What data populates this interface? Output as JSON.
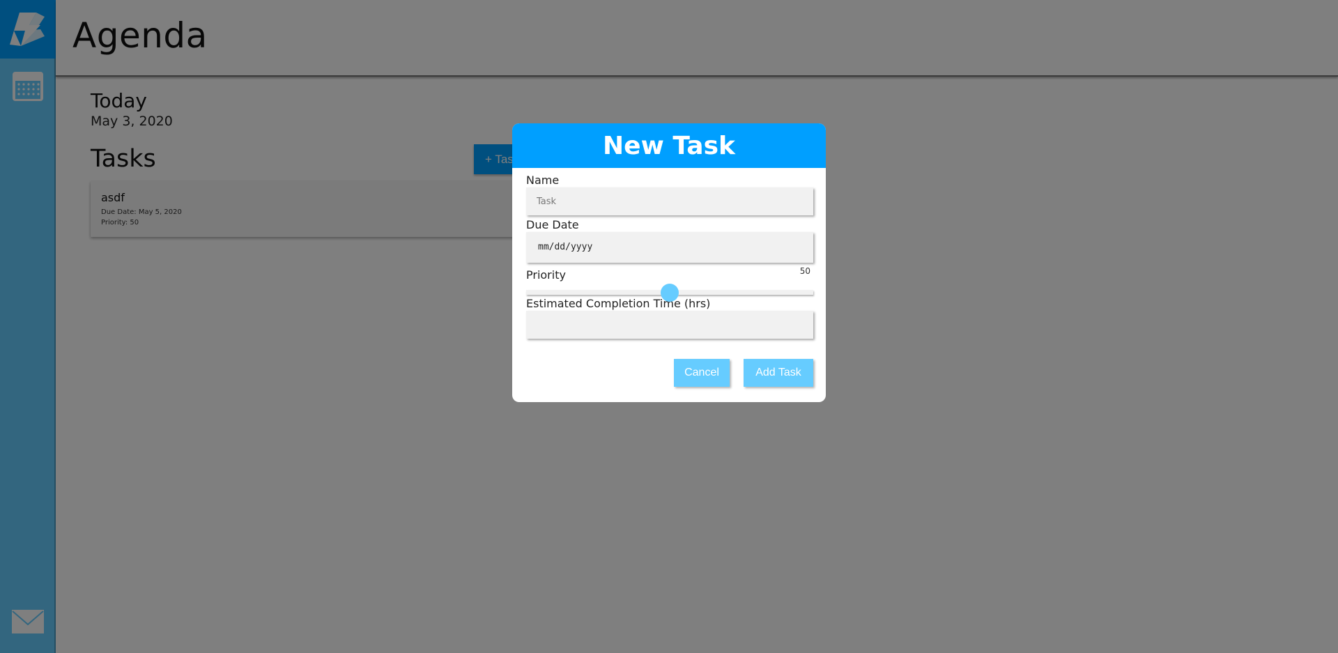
{
  "sidebar": {
    "logo_icon": "lightning-bolt-logo",
    "nav": [
      {
        "icon": "calendar-icon"
      },
      {
        "icon": "mail-icon"
      }
    ],
    "accent_color": "#66ccff",
    "logo_bg": "#009fff"
  },
  "header": {
    "title": "Agenda"
  },
  "main": {
    "today_label": "Today",
    "today_date": "May 3, 2020",
    "tasks_label": "Tasks",
    "add_task_button": "+ Task",
    "tasks": [
      {
        "name": "asdf",
        "due": "Due Date: May 5, 2020",
        "priority": "Priority: 50"
      }
    ]
  },
  "modal": {
    "title": "New Task",
    "name_label": "Name",
    "name_placeholder": "Task",
    "due_label": "Due Date",
    "due_placeholder": "mm/dd/yyyy",
    "priority_label": "Priority",
    "priority_value": "50",
    "priority_fraction": 0.5,
    "time_label": "Estimated Completion Time (hrs)",
    "time_value": "",
    "cancel_label": "Cancel",
    "add_label": "Add Task",
    "header_color": "#009fff",
    "button_color": "#66ccff"
  }
}
